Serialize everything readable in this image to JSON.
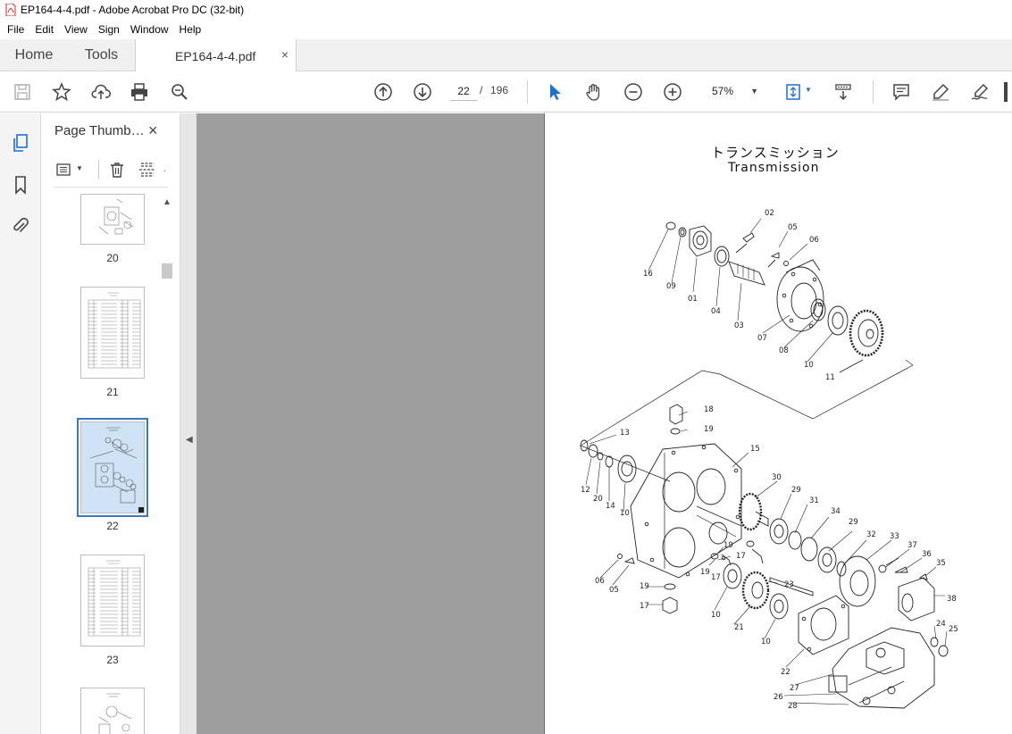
{
  "window": {
    "title": "EP164-4-4.pdf - Adobe Acrobat Pro DC (32-bit)"
  },
  "menu": {
    "items": [
      "File",
      "Edit",
      "View",
      "Sign",
      "Window",
      "Help"
    ]
  },
  "tabs": {
    "home": "Home",
    "tools": "Tools",
    "document": "EP164-4-4.pdf",
    "close_glyph": "×"
  },
  "toolbar": {
    "page_current": "22",
    "page_separator": "/",
    "page_total": "196",
    "zoom": "57%"
  },
  "panel": {
    "title": "Page Thumb…",
    "thumbnails": [
      {
        "number": "20",
        "selected": false
      },
      {
        "number": "21",
        "selected": false
      },
      {
        "number": "22",
        "selected": true
      },
      {
        "number": "23",
        "selected": false
      }
    ]
  },
  "document": {
    "title_jp": "トランスミッション",
    "title_en": "Transmission",
    "callouts": [
      "02",
      "05",
      "06",
      "16",
      "09",
      "01",
      "04",
      "03",
      "07",
      "08",
      "10",
      "11",
      "18",
      "19",
      "13",
      "15",
      "12",
      "20",
      "14",
      "10",
      "30",
      "29",
      "31",
      "34",
      "29",
      "32",
      "33",
      "37",
      "36",
      "35",
      "38",
      "19",
      "17",
      "17",
      "19",
      "06",
      "05",
      "19",
      "17",
      "23",
      "21",
      "10",
      "10",
      "24",
      "25",
      "22",
      "27",
      "26",
      "28"
    ]
  },
  "colors": {
    "accent": "#3a78c4",
    "docBackground": "#9e9e9e",
    "pdfRed": "#d9261c"
  },
  "icons": [
    "save-icon",
    "bookmark-star-icon",
    "upload-icon",
    "print-icon",
    "zoom-search-icon",
    "page-up-icon",
    "page-down-icon",
    "select-cursor-icon",
    "hand-icon",
    "zoom-out-icon",
    "zoom-in-icon",
    "fit-page-icon",
    "scroll-mode-icon",
    "comment-icon",
    "highlight-icon",
    "sign-icon"
  ]
}
